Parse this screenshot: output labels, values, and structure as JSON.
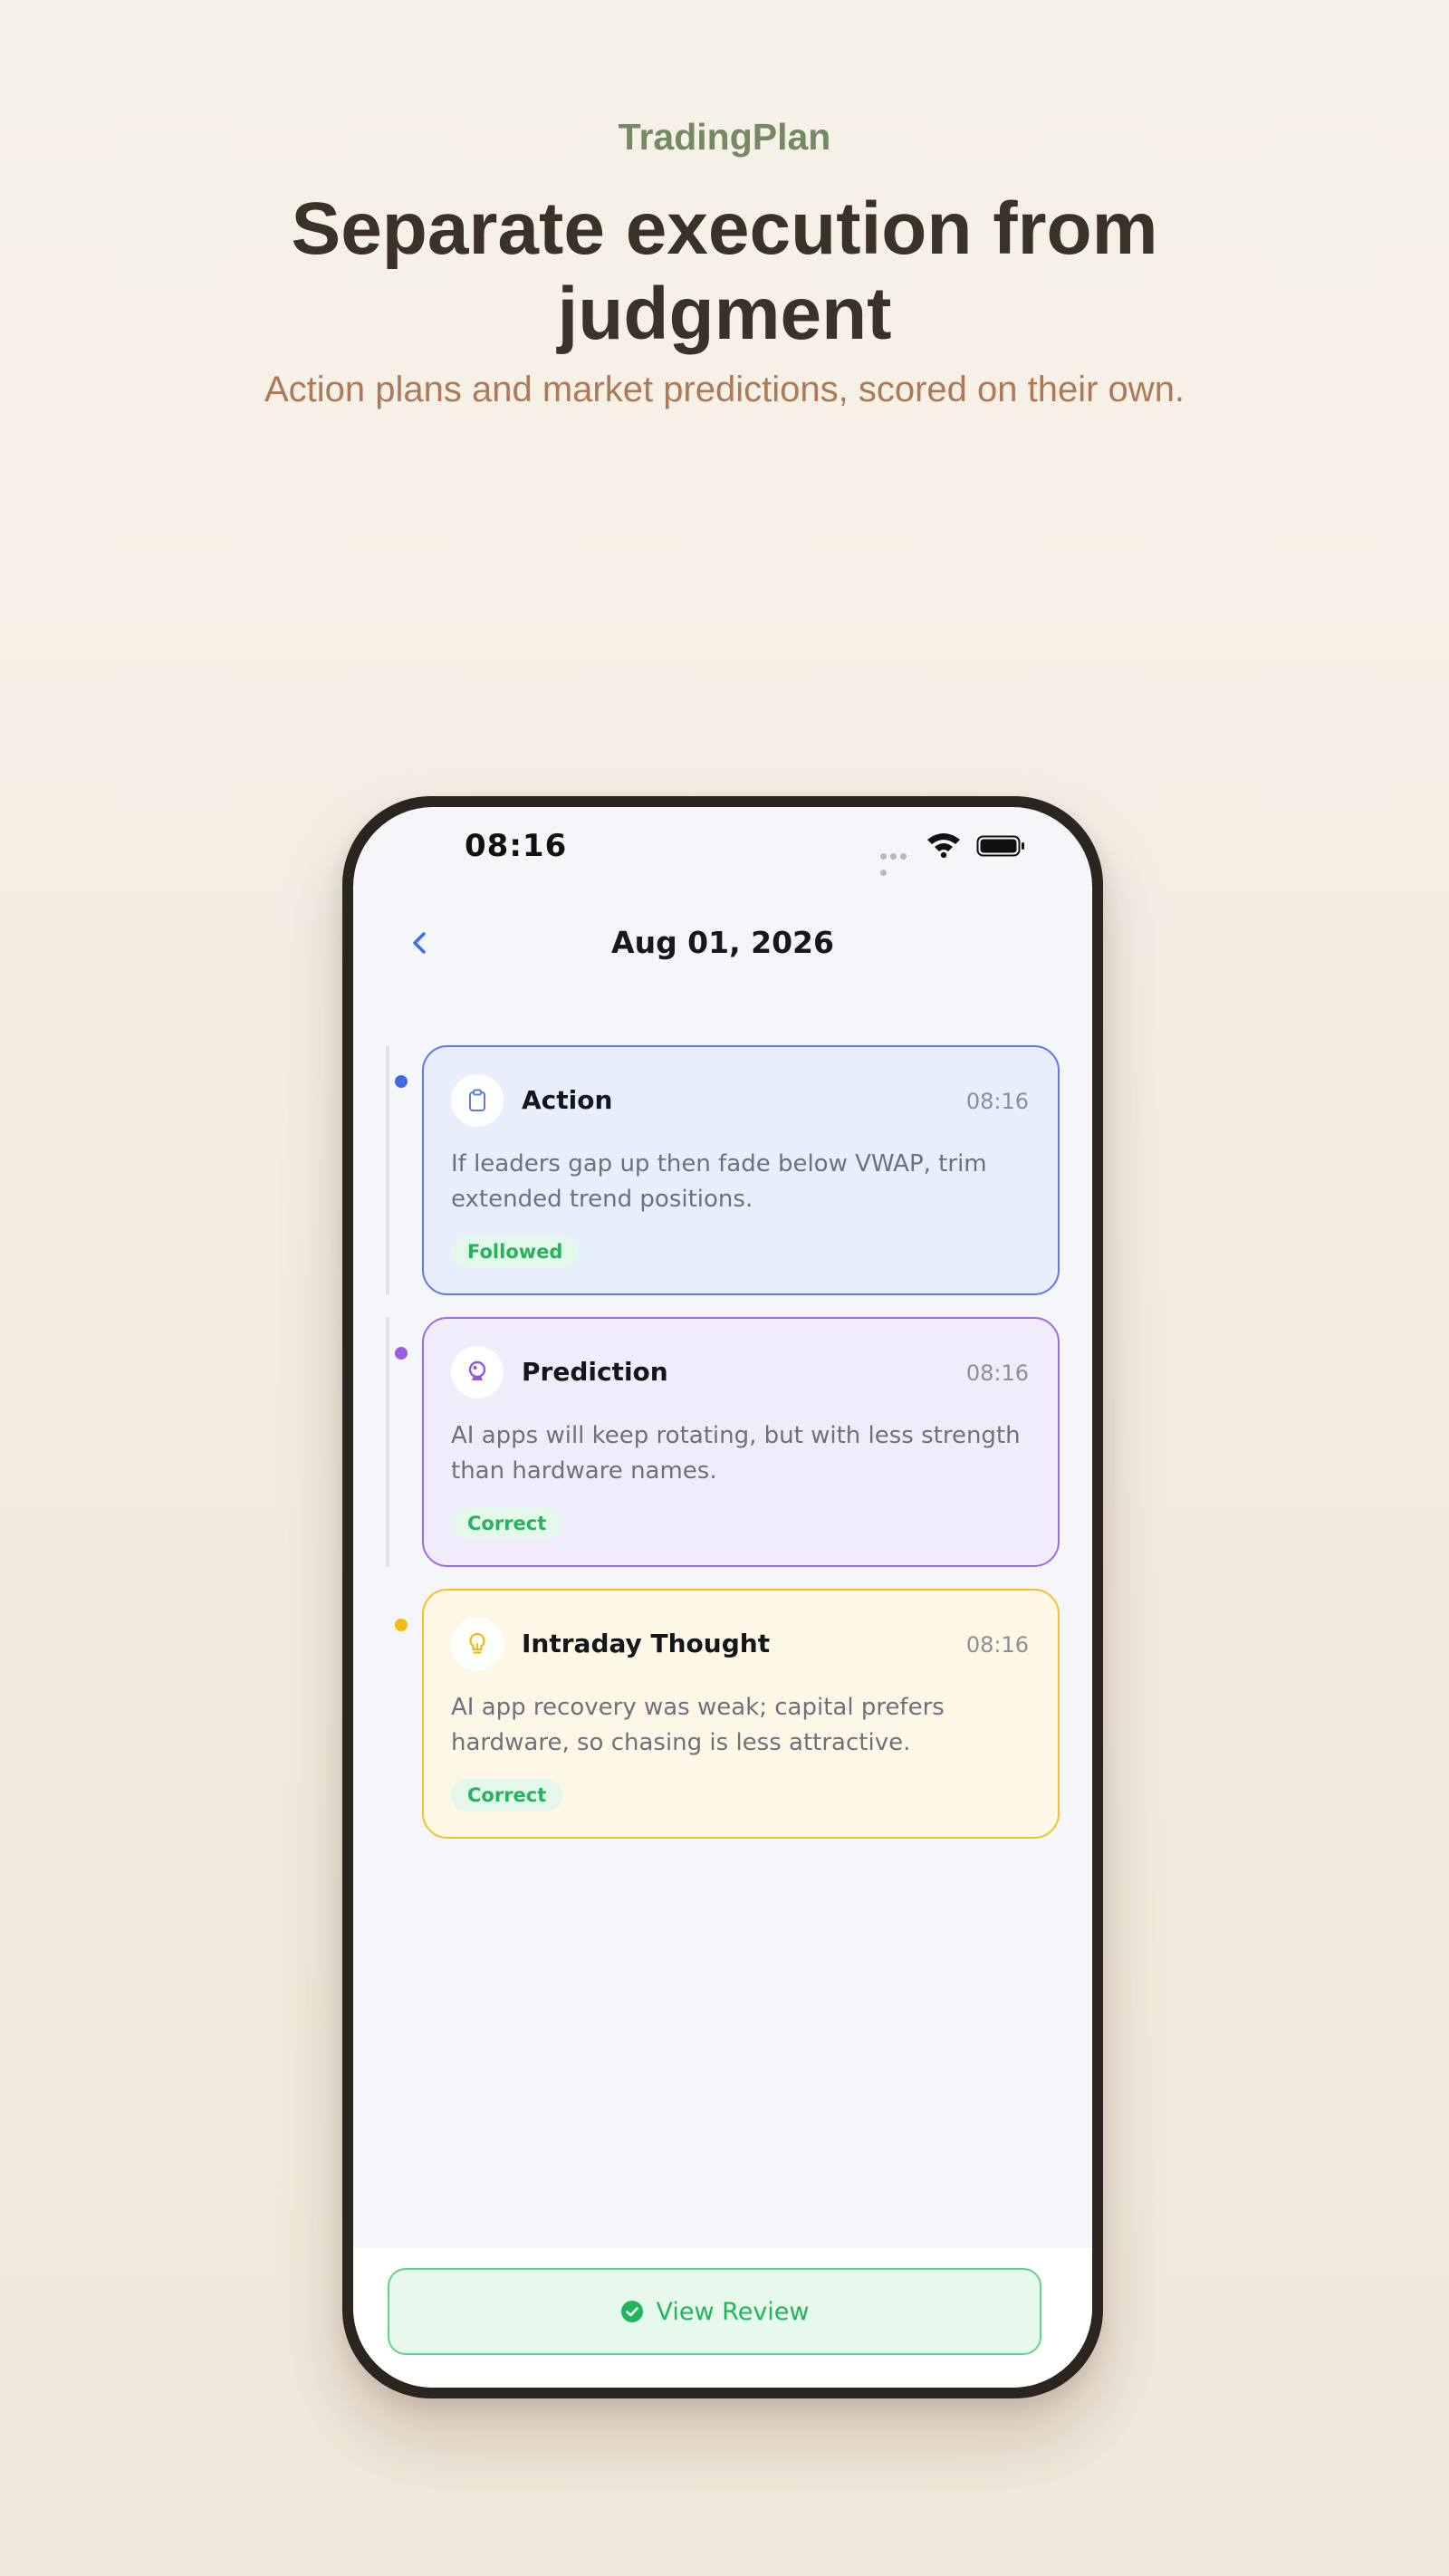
{
  "brand": "TradingPlan",
  "headline": "Separate execution from judgment",
  "subtitle": "Action plans and market predictions, scored on their own.",
  "status_bar": {
    "time": "08:16"
  },
  "nav": {
    "title": "Aug 01, 2026"
  },
  "entries": [
    {
      "type": "Action",
      "time": "08:16",
      "text": "If leaders gap up then fade below VWAP, trim extended trend positions.",
      "badge": "Followed",
      "icon": "clipboard-icon",
      "accent": "#5b7be6",
      "bg": "#e9eefc"
    },
    {
      "type": "Prediction",
      "time": "08:16",
      "text": "AI apps will keep rotating, but with less strength than hardware names.",
      "badge": "Correct",
      "icon": "crystal-ball-icon",
      "accent": "#9b6be4",
      "bg": "#f1ecfb"
    },
    {
      "type": "Intraday Thought",
      "time": "08:16",
      "text": "AI app recovery was weak; capital prefers hardware, so chasing is less attractive.",
      "badge": "Correct",
      "icon": "lightbulb-icon",
      "accent": "#f3c22a",
      "bg": "#fdf7e6"
    }
  ],
  "footer": {
    "button_label": "View Review"
  },
  "colors": {
    "brand": "#748a62",
    "headline": "#3b3126",
    "subtitle": "#ad7a58",
    "success": "#22b55b"
  }
}
